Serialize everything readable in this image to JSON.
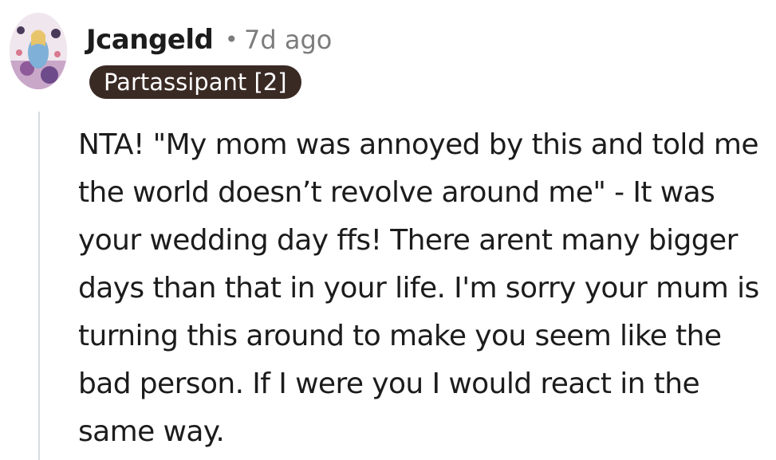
{
  "comment": {
    "author": "Jcangeld",
    "separator": "•",
    "time_ago": "7d ago",
    "flair": "Partassipant [2]",
    "avatar_icon": "user-avatar-icon",
    "body": "NTA! \"My mom was annoyed by this and told me the world doesn’t revolve around me\" - It was your wedding day ffs! There arent many bigger days than that in your life. I'm sorry your mum is turning this around to make you seem like the bad person. If I were you I would react in the same way."
  },
  "colors": {
    "flair_background": "#3a2a24",
    "flair_text": "#ffffff",
    "meta_text": "#7c7c7c",
    "thread_line": "#d9dcde"
  }
}
